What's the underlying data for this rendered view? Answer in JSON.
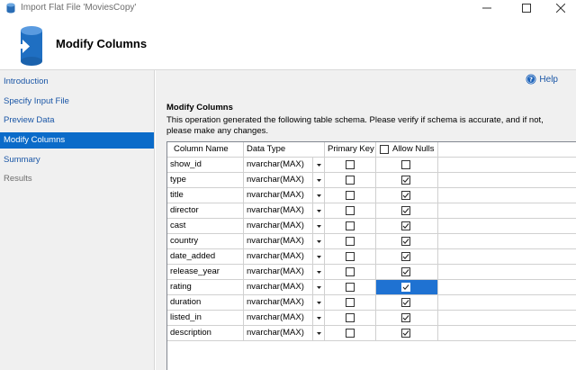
{
  "window": {
    "title": "Import Flat File 'MoviesCopy'",
    "app_icon": "sql-server-icon"
  },
  "header": {
    "title": "Modify Columns",
    "icon": "database-import-icon"
  },
  "nav": {
    "items": [
      {
        "label": "Introduction",
        "state": "link"
      },
      {
        "label": "Specify Input File",
        "state": "link"
      },
      {
        "label": "Preview Data",
        "state": "link"
      },
      {
        "label": "Modify Columns",
        "state": "active"
      },
      {
        "label": "Summary",
        "state": "link"
      },
      {
        "label": "Results",
        "state": "disabled"
      }
    ]
  },
  "main": {
    "help_label": "Help",
    "section_title": "Modify Columns",
    "description": "This operation generated the following table schema. Please verify if schema is accurate, and if not, please make any changes."
  },
  "grid": {
    "headers": {
      "column_name": "Column Name",
      "data_type": "Data Type",
      "primary_key": "Primary Key",
      "allow_nulls": "Allow Nulls"
    },
    "allow_nulls_header_checked": false,
    "rows": [
      {
        "name": "show_id",
        "type": "nvarchar(MAX)",
        "pk": false,
        "nulls": false
      },
      {
        "name": "type",
        "type": "nvarchar(MAX)",
        "pk": false,
        "nulls": true
      },
      {
        "name": "title",
        "type": "nvarchar(MAX)",
        "pk": false,
        "nulls": true
      },
      {
        "name": "director",
        "type": "nvarchar(MAX)",
        "pk": false,
        "nulls": true
      },
      {
        "name": "cast",
        "type": "nvarchar(MAX)",
        "pk": false,
        "nulls": true
      },
      {
        "name": "country",
        "type": "nvarchar(MAX)",
        "pk": false,
        "nulls": true
      },
      {
        "name": "date_added",
        "type": "nvarchar(MAX)",
        "pk": false,
        "nulls": true
      },
      {
        "name": "release_year",
        "type": "nvarchar(MAX)",
        "pk": false,
        "nulls": true
      },
      {
        "name": "rating",
        "type": "nvarchar(MAX)",
        "pk": false,
        "nulls": true,
        "selected": true
      },
      {
        "name": "duration",
        "type": "nvarchar(MAX)",
        "pk": false,
        "nulls": true
      },
      {
        "name": "listed_in",
        "type": "nvarchar(MAX)",
        "pk": false,
        "nulls": true
      },
      {
        "name": "description",
        "type": "nvarchar(MAX)",
        "pk": false,
        "nulls": true
      }
    ]
  },
  "colors": {
    "accent": "#0b6bc9",
    "link": "#1a56a6",
    "selected_cell": "#1f72d2"
  }
}
